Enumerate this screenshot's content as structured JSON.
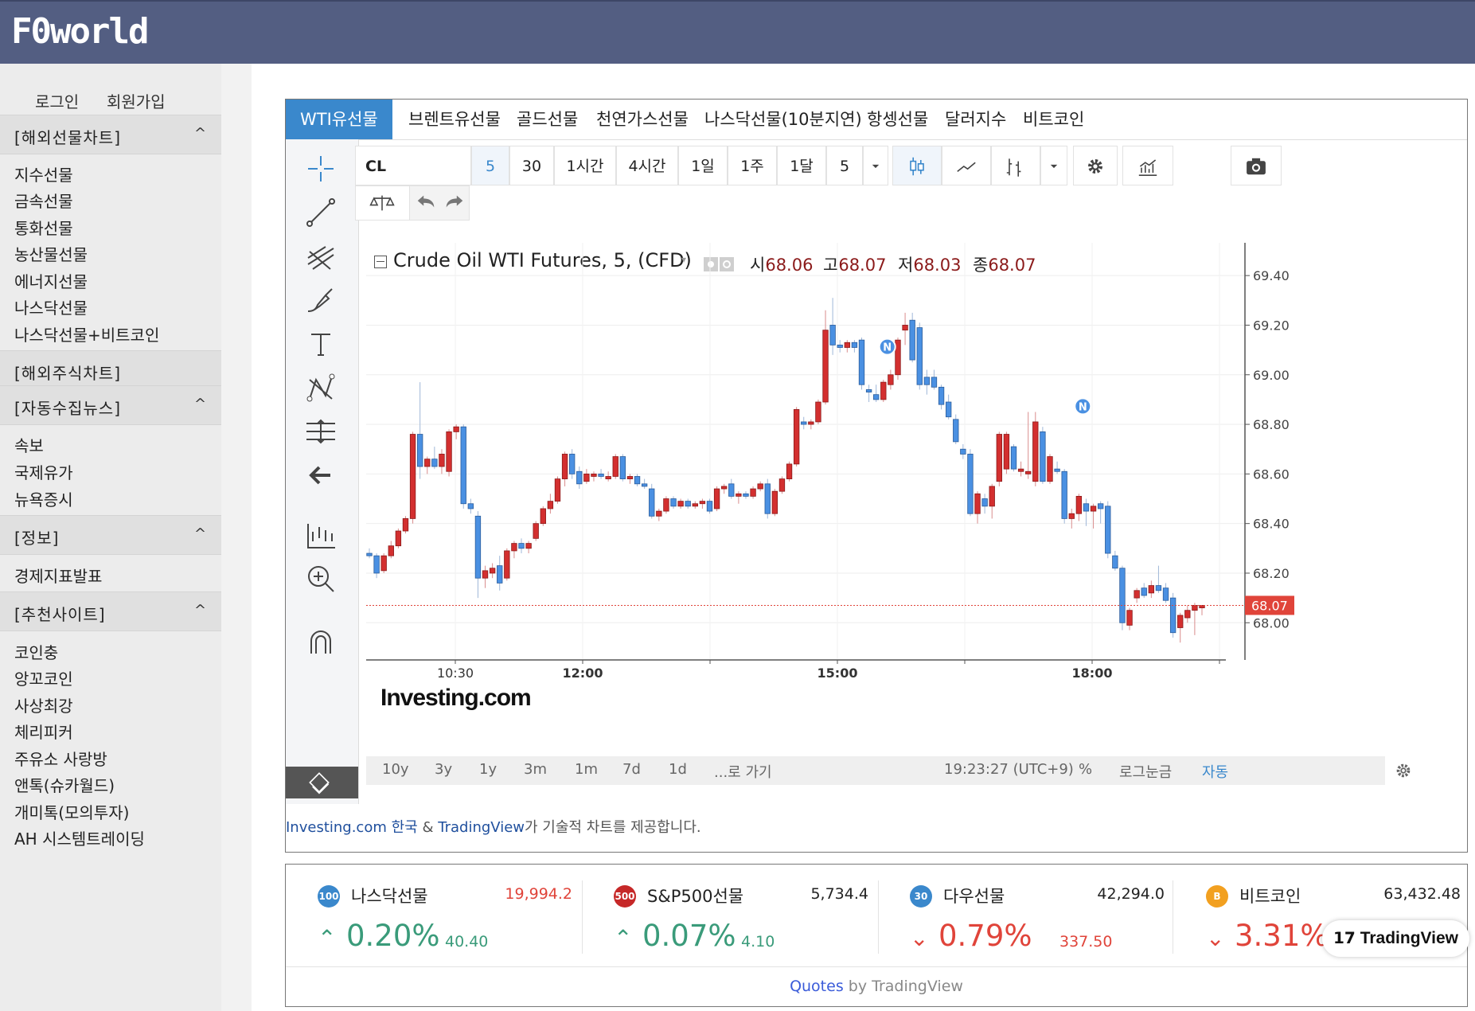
{
  "header": {
    "logo": "F0world"
  },
  "sidebar": {
    "auth": {
      "login": "로그인",
      "signup": "회원가입"
    },
    "sections": [
      {
        "title": "[해외선물차트]",
        "caret": "^",
        "items": [
          "지수선물",
          "금속선물",
          "통화선물",
          "농산물선물",
          "에너지선물",
          "나스닥선물",
          "나스닥선물+비트코인"
        ]
      },
      {
        "title": "[해외주식차트]",
        "caret": "",
        "items": []
      },
      {
        "title": "[자동수집뉴스]",
        "caret": "^",
        "items": [
          "속보",
          "국제유가",
          "뉴욕증시"
        ]
      },
      {
        "title": "[정보]",
        "caret": "^",
        "items": [
          "경제지표발표"
        ]
      },
      {
        "title": "[추천사이트]",
        "caret": "^",
        "items": [
          "코인충",
          "앙꼬코인",
          "사상최강",
          "체리피커",
          "주유소 사랑방",
          "앤톡(슈카월드)",
          "개미톡(모의투자)",
          "AH 시스템트레이딩"
        ]
      }
    ]
  },
  "tabs": [
    "WTI유선물",
    "브렌트유선물",
    "골드선물",
    "천연가스선물",
    "나스닥선물(10분지연)",
    "항셍선물",
    "달러지수",
    "비트코인"
  ],
  "active_tab": 0,
  "toolbar": {
    "symbol": "CL",
    "intervals": [
      "5",
      "30",
      "1시간",
      "4시간",
      "1일",
      "1주",
      "1달",
      "5"
    ],
    "active_interval": 0
  },
  "left_tools": [
    "crosshair-icon",
    "trendline-icon",
    "fib-icon",
    "brush-icon",
    "text-icon",
    "pattern-icon",
    "measure-icon",
    "back-arrow-icon",
    "long-position-icon",
    "zoom-in-icon",
    "magnet-icon",
    "lock-drawing-icon"
  ],
  "chart_header": {
    "title": "Crude Oil WTI Futures, 5, (CFD)",
    "ohlc": [
      {
        "label": "시",
        "value": "68.06"
      },
      {
        "label": "고",
        "value": "68.07"
      },
      {
        "label": "저",
        "value": "68.03"
      },
      {
        "label": "종",
        "value": "68.07"
      }
    ],
    "watermark": "Investing.com"
  },
  "chart_data": {
    "type": "candlestick",
    "title": "Crude Oil WTI Futures, 5, (CFD)",
    "ylim": [
      67.85,
      69.5
    ],
    "y_ticks": [
      "69.40",
      "69.20",
      "69.00",
      "68.80",
      "68.60",
      "68.40",
      "68.20",
      "68.00"
    ],
    "x_ticks": [
      "10:30",
      "12:00",
      "15:00",
      "18:00"
    ],
    "last_price": "68.07",
    "news_markers": [
      "N",
      "N"
    ],
    "candles": [
      {
        "o": 68.28,
        "h": 68.3,
        "l": 68.26,
        "c": 68.27
      },
      {
        "o": 68.27,
        "h": 68.28,
        "l": 68.18,
        "c": 68.2
      },
      {
        "o": 68.21,
        "h": 68.28,
        "l": 68.2,
        "c": 68.27
      },
      {
        "o": 68.27,
        "h": 68.33,
        "l": 68.26,
        "c": 68.31
      },
      {
        "o": 68.31,
        "h": 68.38,
        "l": 68.3,
        "c": 68.37
      },
      {
        "o": 68.37,
        "h": 68.43,
        "l": 68.36,
        "c": 68.42
      },
      {
        "o": 68.42,
        "h": 68.77,
        "l": 68.4,
        "c": 68.76
      },
      {
        "o": 68.76,
        "h": 68.97,
        "l": 68.58,
        "c": 68.63
      },
      {
        "o": 68.63,
        "h": 68.67,
        "l": 68.6,
        "c": 68.66
      },
      {
        "o": 68.66,
        "h": 68.71,
        "l": 68.62,
        "c": 68.63
      },
      {
        "o": 68.63,
        "h": 68.7,
        "l": 68.6,
        "c": 68.68
      },
      {
        "o": 68.61,
        "h": 68.78,
        "l": 68.59,
        "c": 68.77
      },
      {
        "o": 68.77,
        "h": 68.8,
        "l": 68.74,
        "c": 68.79
      },
      {
        "o": 68.79,
        "h": 68.8,
        "l": 68.46,
        "c": 68.48
      },
      {
        "o": 68.48,
        "h": 68.5,
        "l": 68.44,
        "c": 68.46
      },
      {
        "o": 68.43,
        "h": 68.45,
        "l": 68.1,
        "c": 68.18
      },
      {
        "o": 68.18,
        "h": 68.23,
        "l": 68.14,
        "c": 68.21
      },
      {
        "o": 68.2,
        "h": 68.24,
        "l": 68.18,
        "c": 68.22
      },
      {
        "o": 68.23,
        "h": 68.27,
        "l": 68.13,
        "c": 68.16
      },
      {
        "o": 68.18,
        "h": 68.3,
        "l": 68.17,
        "c": 68.29
      },
      {
        "o": 68.29,
        "h": 68.33,
        "l": 68.26,
        "c": 68.32
      },
      {
        "o": 68.32,
        "h": 68.34,
        "l": 68.28,
        "c": 68.3
      },
      {
        "o": 68.3,
        "h": 68.33,
        "l": 68.28,
        "c": 68.32
      },
      {
        "o": 68.34,
        "h": 68.41,
        "l": 68.33,
        "c": 68.4
      },
      {
        "o": 68.4,
        "h": 68.47,
        "l": 68.39,
        "c": 68.46
      },
      {
        "o": 68.46,
        "h": 68.52,
        "l": 68.44,
        "c": 68.49
      },
      {
        "o": 68.49,
        "h": 68.59,
        "l": 68.48,
        "c": 68.58
      },
      {
        "o": 68.58,
        "h": 68.69,
        "l": 68.55,
        "c": 68.68
      },
      {
        "o": 68.68,
        "h": 68.7,
        "l": 68.58,
        "c": 68.6
      },
      {
        "o": 68.61,
        "h": 68.63,
        "l": 68.54,
        "c": 68.56
      },
      {
        "o": 68.57,
        "h": 68.62,
        "l": 68.56,
        "c": 68.6
      },
      {
        "o": 68.59,
        "h": 68.61,
        "l": 68.57,
        "c": 68.6
      },
      {
        "o": 68.6,
        "h": 68.62,
        "l": 68.58,
        "c": 68.59
      },
      {
        "o": 68.58,
        "h": 68.61,
        "l": 68.57,
        "c": 68.59
      },
      {
        "o": 68.59,
        "h": 68.68,
        "l": 68.58,
        "c": 68.67
      },
      {
        "o": 68.67,
        "h": 68.68,
        "l": 68.57,
        "c": 68.58
      },
      {
        "o": 68.58,
        "h": 68.6,
        "l": 68.56,
        "c": 68.59
      },
      {
        "o": 68.59,
        "h": 68.6,
        "l": 68.55,
        "c": 68.56
      },
      {
        "o": 68.56,
        "h": 68.58,
        "l": 68.54,
        "c": 68.55
      },
      {
        "o": 68.54,
        "h": 68.56,
        "l": 68.42,
        "c": 68.43
      },
      {
        "o": 68.43,
        "h": 68.46,
        "l": 68.41,
        "c": 68.45
      },
      {
        "o": 68.45,
        "h": 68.51,
        "l": 68.44,
        "c": 68.5
      },
      {
        "o": 68.5,
        "h": 68.51,
        "l": 68.46,
        "c": 68.47
      },
      {
        "o": 68.47,
        "h": 68.5,
        "l": 68.46,
        "c": 68.49
      },
      {
        "o": 68.49,
        "h": 68.5,
        "l": 68.46,
        "c": 68.47
      },
      {
        "o": 68.47,
        "h": 68.49,
        "l": 68.46,
        "c": 68.48
      },
      {
        "o": 68.48,
        "h": 68.5,
        "l": 68.46,
        "c": 68.49
      },
      {
        "o": 68.49,
        "h": 68.5,
        "l": 68.44,
        "c": 68.45
      },
      {
        "o": 68.46,
        "h": 68.55,
        "l": 68.45,
        "c": 68.54
      },
      {
        "o": 68.54,
        "h": 68.56,
        "l": 68.52,
        "c": 68.55
      },
      {
        "o": 68.56,
        "h": 68.58,
        "l": 68.5,
        "c": 68.51
      },
      {
        "o": 68.51,
        "h": 68.53,
        "l": 68.48,
        "c": 68.52
      },
      {
        "o": 68.52,
        "h": 68.53,
        "l": 68.5,
        "c": 68.51
      },
      {
        "o": 68.51,
        "h": 68.55,
        "l": 68.5,
        "c": 68.54
      },
      {
        "o": 68.54,
        "h": 68.57,
        "l": 68.53,
        "c": 68.56
      },
      {
        "o": 68.56,
        "h": 68.58,
        "l": 68.42,
        "c": 68.44
      },
      {
        "o": 68.44,
        "h": 68.54,
        "l": 68.43,
        "c": 68.53
      },
      {
        "o": 68.53,
        "h": 68.59,
        "l": 68.52,
        "c": 68.58
      },
      {
        "o": 68.58,
        "h": 68.65,
        "l": 68.57,
        "c": 68.64
      },
      {
        "o": 68.64,
        "h": 68.87,
        "l": 68.63,
        "c": 68.86
      },
      {
        "o": 68.81,
        "h": 68.83,
        "l": 68.78,
        "c": 68.8
      },
      {
        "o": 68.8,
        "h": 68.82,
        "l": 68.78,
        "c": 68.81
      },
      {
        "o": 68.81,
        "h": 68.9,
        "l": 68.8,
        "c": 68.89
      },
      {
        "o": 68.89,
        "h": 69.26,
        "l": 68.88,
        "c": 69.18
      },
      {
        "o": 69.2,
        "h": 69.31,
        "l": 69.08,
        "c": 69.12
      },
      {
        "o": 69.12,
        "h": 69.14,
        "l": 69.09,
        "c": 69.11
      },
      {
        "o": 69.11,
        "h": 69.14,
        "l": 69.09,
        "c": 69.13
      },
      {
        "o": 69.13,
        "h": 69.14,
        "l": 69.09,
        "c": 69.11
      },
      {
        "o": 69.14,
        "h": 69.15,
        "l": 68.94,
        "c": 68.96
      },
      {
        "o": 68.94,
        "h": 68.96,
        "l": 68.89,
        "c": 68.93
      },
      {
        "o": 68.92,
        "h": 68.96,
        "l": 68.89,
        "c": 68.9
      },
      {
        "o": 68.9,
        "h": 68.98,
        "l": 68.89,
        "c": 68.97
      },
      {
        "o": 68.96,
        "h": 69.02,
        "l": 68.94,
        "c": 69.0
      },
      {
        "o": 69.0,
        "h": 69.15,
        "l": 68.98,
        "c": 69.14
      },
      {
        "o": 69.18,
        "h": 69.25,
        "l": 69.12,
        "c": 69.2
      },
      {
        "o": 69.22,
        "h": 69.25,
        "l": 69.05,
        "c": 69.06
      },
      {
        "o": 69.19,
        "h": 69.21,
        "l": 68.94,
        "c": 68.96
      },
      {
        "o": 68.99,
        "h": 69.02,
        "l": 68.92,
        "c": 68.96
      },
      {
        "o": 68.99,
        "h": 69.02,
        "l": 68.94,
        "c": 68.95
      },
      {
        "o": 68.95,
        "h": 68.96,
        "l": 68.86,
        "c": 68.88
      },
      {
        "o": 68.89,
        "h": 68.92,
        "l": 68.82,
        "c": 68.83
      },
      {
        "o": 68.82,
        "h": 68.84,
        "l": 68.72,
        "c": 68.73
      },
      {
        "o": 68.7,
        "h": 68.72,
        "l": 68.66,
        "c": 68.68
      },
      {
        "o": 68.68,
        "h": 68.7,
        "l": 68.43,
        "c": 68.44
      },
      {
        "o": 68.44,
        "h": 68.53,
        "l": 68.4,
        "c": 68.52
      },
      {
        "o": 68.5,
        "h": 68.52,
        "l": 68.44,
        "c": 68.47
      },
      {
        "o": 68.47,
        "h": 68.56,
        "l": 68.42,
        "c": 68.55
      },
      {
        "o": 68.57,
        "h": 68.77,
        "l": 68.55,
        "c": 68.76
      },
      {
        "o": 68.62,
        "h": 68.77,
        "l": 68.6,
        "c": 68.76
      },
      {
        "o": 68.71,
        "h": 68.72,
        "l": 68.61,
        "c": 68.62
      },
      {
        "o": 68.61,
        "h": 68.65,
        "l": 68.59,
        "c": 68.62
      },
      {
        "o": 68.6,
        "h": 68.85,
        "l": 68.58,
        "c": 68.61
      },
      {
        "o": 68.57,
        "h": 68.85,
        "l": 68.55,
        "c": 68.81
      },
      {
        "o": 68.77,
        "h": 68.79,
        "l": 68.56,
        "c": 68.57
      },
      {
        "o": 68.57,
        "h": 68.68,
        "l": 68.56,
        "c": 68.67
      },
      {
        "o": 68.62,
        "h": 68.65,
        "l": 68.6,
        "c": 68.61
      },
      {
        "o": 68.61,
        "h": 68.62,
        "l": 68.4,
        "c": 68.42
      },
      {
        "o": 68.42,
        "h": 68.46,
        "l": 68.38,
        "c": 68.44
      },
      {
        "o": 68.44,
        "h": 68.52,
        "l": 68.41,
        "c": 68.51
      },
      {
        "o": 68.48,
        "h": 68.5,
        "l": 68.39,
        "c": 68.45
      },
      {
        "o": 68.45,
        "h": 68.48,
        "l": 68.38,
        "c": 68.47
      },
      {
        "o": 68.48,
        "h": 68.49,
        "l": 68.4,
        "c": 68.46
      },
      {
        "o": 68.47,
        "h": 68.49,
        "l": 68.26,
        "c": 68.28
      },
      {
        "o": 68.27,
        "h": 68.29,
        "l": 68.21,
        "c": 68.22
      },
      {
        "o": 68.22,
        "h": 68.23,
        "l": 67.97,
        "c": 68.0
      },
      {
        "o": 67.99,
        "h": 68.06,
        "l": 67.97,
        "c": 68.05
      },
      {
        "o": 68.1,
        "h": 68.14,
        "l": 68.08,
        "c": 68.13
      },
      {
        "o": 68.14,
        "h": 68.16,
        "l": 68.1,
        "c": 68.11
      },
      {
        "o": 68.12,
        "h": 68.17,
        "l": 68.1,
        "c": 68.15
      },
      {
        "o": 68.15,
        "h": 68.23,
        "l": 68.12,
        "c": 68.13
      },
      {
        "o": 68.14,
        "h": 68.16,
        "l": 68.08,
        "c": 68.09
      },
      {
        "o": 68.1,
        "h": 68.12,
        "l": 67.94,
        "c": 67.96
      },
      {
        "o": 67.98,
        "h": 68.04,
        "l": 67.92,
        "c": 68.03
      },
      {
        "o": 68.02,
        "h": 68.07,
        "l": 68.0,
        "c": 68.05
      },
      {
        "o": 68.05,
        "h": 68.08,
        "l": 67.95,
        "c": 68.07
      },
      {
        "o": 68.06,
        "h": 68.07,
        "l": 68.03,
        "c": 68.07
      }
    ]
  },
  "bottom_bar": {
    "ranges": [
      "10y",
      "3y",
      "1y",
      "3m",
      "1m",
      "7d",
      "1d",
      "...로 가기"
    ],
    "time": "19:23:27 (UTC+9)",
    "pct": "%",
    "log": "로그눈금",
    "auto": "자동"
  },
  "credit": {
    "link1": "Investing.com 한국",
    "amp": "&",
    "link2": "TradingView",
    "text": "가 기술적 차트를 제공합니다."
  },
  "tickers": [
    {
      "badge": "100",
      "name": "나스닥선물",
      "price": "19,994.2",
      "pct": "0.20%",
      "change": "40.40",
      "dir": "up",
      "price_color": "#e0443a",
      "badge_color": "#3a88cc"
    },
    {
      "badge": "500",
      "name": "S&P500선물",
      "price": "5,734.4",
      "pct": "0.07%",
      "change": "4.10",
      "dir": "up",
      "price_color": "#222222",
      "badge_color": "#c62828"
    },
    {
      "badge": "30",
      "name": "다우선물",
      "price": "42,294.0",
      "pct": "0.79%",
      "change": "337.50",
      "dir": "down",
      "price_color": "#222222",
      "badge_color": "#3a88cc"
    },
    {
      "badge": "B",
      "name": "비트코인",
      "price": "63,432.48",
      "pct": "3.31%",
      "change": "",
      "dir": "down",
      "price_color": "#222222",
      "badge_color": "#f2a020"
    }
  ],
  "quotes_footer": {
    "quotes": "Quotes",
    "by": "by TradingView"
  },
  "tv_logo": "TradingView",
  "colors": {
    "up": "#d32f2f",
    "down": "#4a90e2",
    "header": "#535e82",
    "active_tab": "#3a88cc"
  }
}
